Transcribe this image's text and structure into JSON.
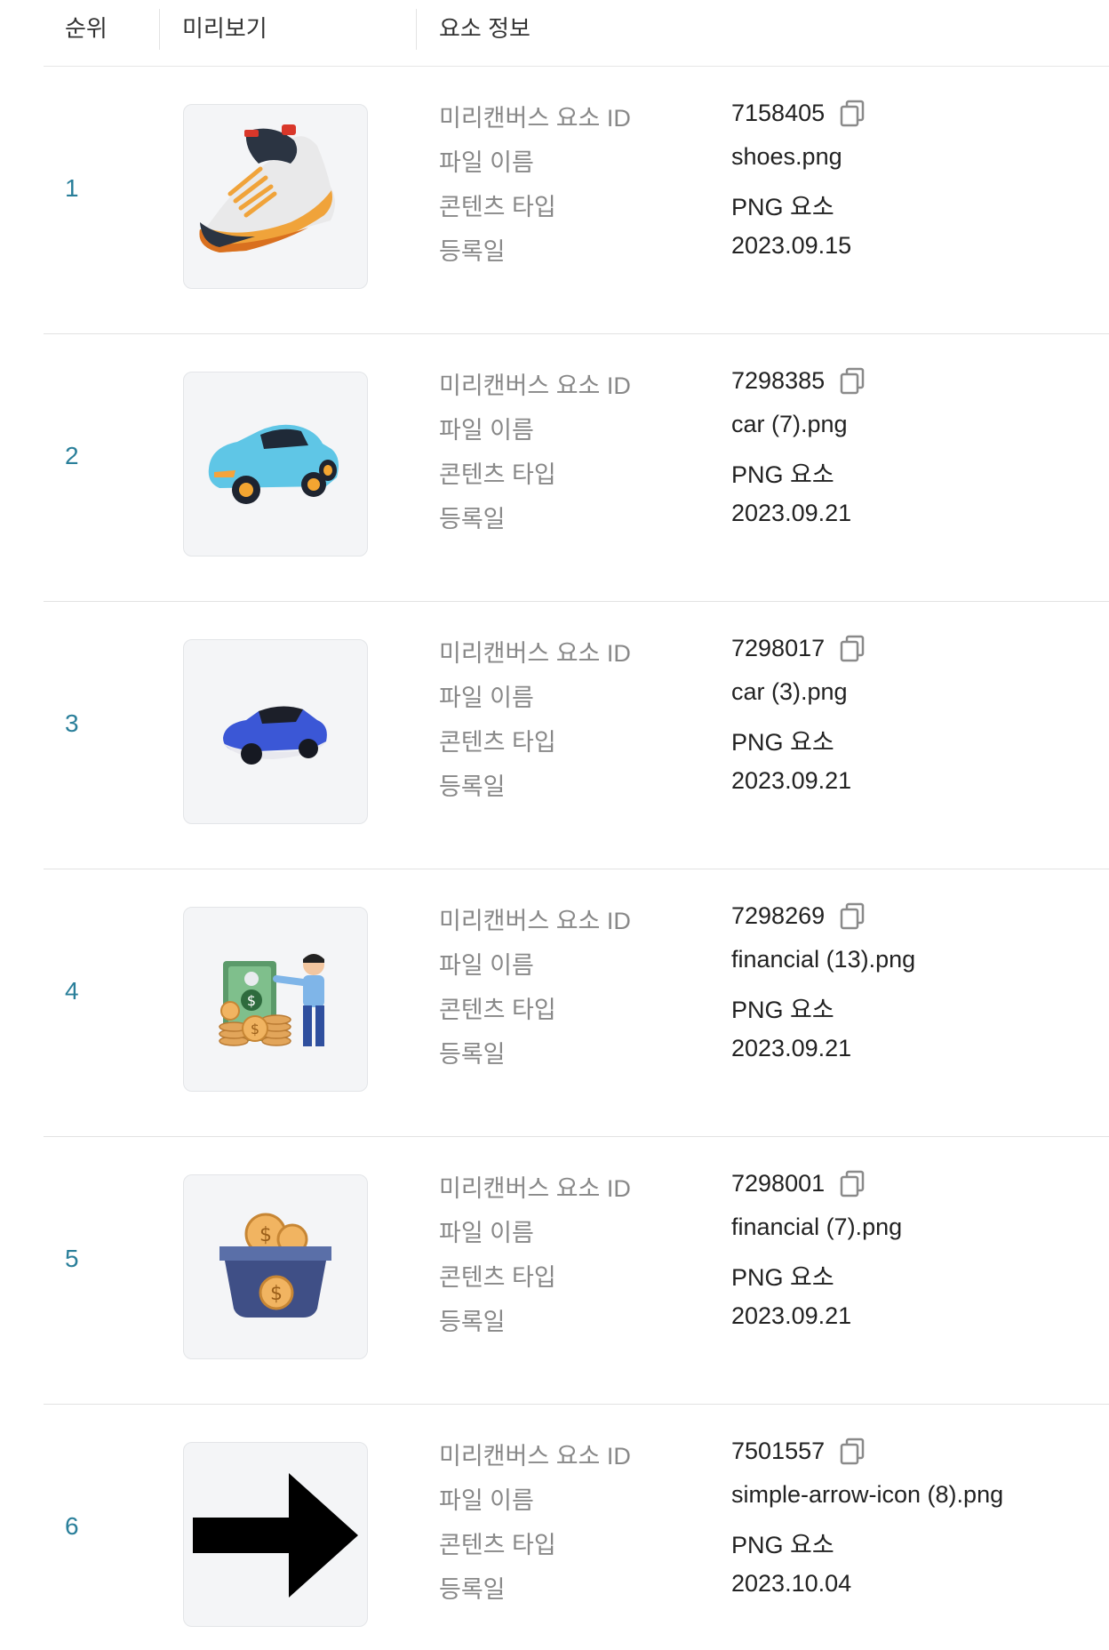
{
  "table": {
    "headers": {
      "rank": "순위",
      "preview": "미리보기",
      "info": "요소 정보"
    },
    "labels": {
      "id": "미리캔버스 요소 ID",
      "file": "파일 이름",
      "type": "콘텐츠 타입",
      "date": "등록일"
    },
    "rows": [
      {
        "rank": "1",
        "id": "7158405",
        "file": "shoes.png",
        "type": "PNG 요소",
        "date": "2023.09.15",
        "preview_icon": "sneaker-icon"
      },
      {
        "rank": "2",
        "id": "7298385",
        "file": "car (7).png",
        "type": "PNG 요소",
        "date": "2023.09.21",
        "preview_icon": "light-blue-car-icon"
      },
      {
        "rank": "3",
        "id": "7298017",
        "file": "car (3).png",
        "type": "PNG 요소",
        "date": "2023.09.21",
        "preview_icon": "blue-car-icon"
      },
      {
        "rank": "4",
        "id": "7298269",
        "file": "financial (13).png",
        "type": "PNG 요소",
        "date": "2023.09.21",
        "preview_icon": "person-with-money-icon"
      },
      {
        "rank": "5",
        "id": "7298001",
        "file": "financial (7).png",
        "type": "PNG 요소",
        "date": "2023.09.21",
        "preview_icon": "coin-basket-icon"
      },
      {
        "rank": "6",
        "id": "7501557",
        "file": "simple-arrow-icon (8).png",
        "type": "PNG 요소",
        "date": "2023.10.04",
        "preview_icon": "right-arrow-icon"
      }
    ]
  },
  "colors": {
    "rank_accent": "#2a7f9a",
    "label_gray": "#888888",
    "thumb_bg": "#f4f5f7"
  }
}
